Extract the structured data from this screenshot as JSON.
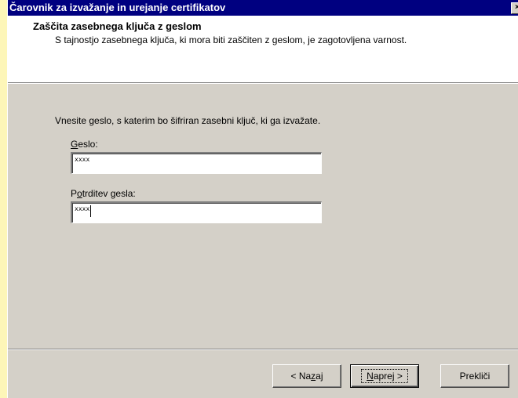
{
  "window": {
    "title": "Čarovnik za izvažanje in urejanje certifikatov",
    "close_glyph": "×"
  },
  "header": {
    "title": "Zaščita zasebnega ključa z geslom",
    "subtitle": "S tajnostjo zasebnega ključa, ki mora biti zaščiten z geslom, je zagotovljena varnost."
  },
  "body": {
    "instruction": "Vnesite geslo, s katerim bo šifriran zasebni ključ, ki ga izvažate.",
    "password": {
      "label_mnemonic": "G",
      "label_rest": "eslo:",
      "value": "xxxx"
    },
    "confirm": {
      "label_prefix": "P",
      "label_mnemonic": "o",
      "label_rest": "trditev gesla:",
      "value": "xxxx"
    }
  },
  "buttons": {
    "back": {
      "prefix": "< Na",
      "mnemonic": "z",
      "suffix": "aj"
    },
    "next": {
      "mnemonic": "N",
      "suffix": "aprej >"
    },
    "cancel": {
      "label": "Prekliči"
    }
  }
}
